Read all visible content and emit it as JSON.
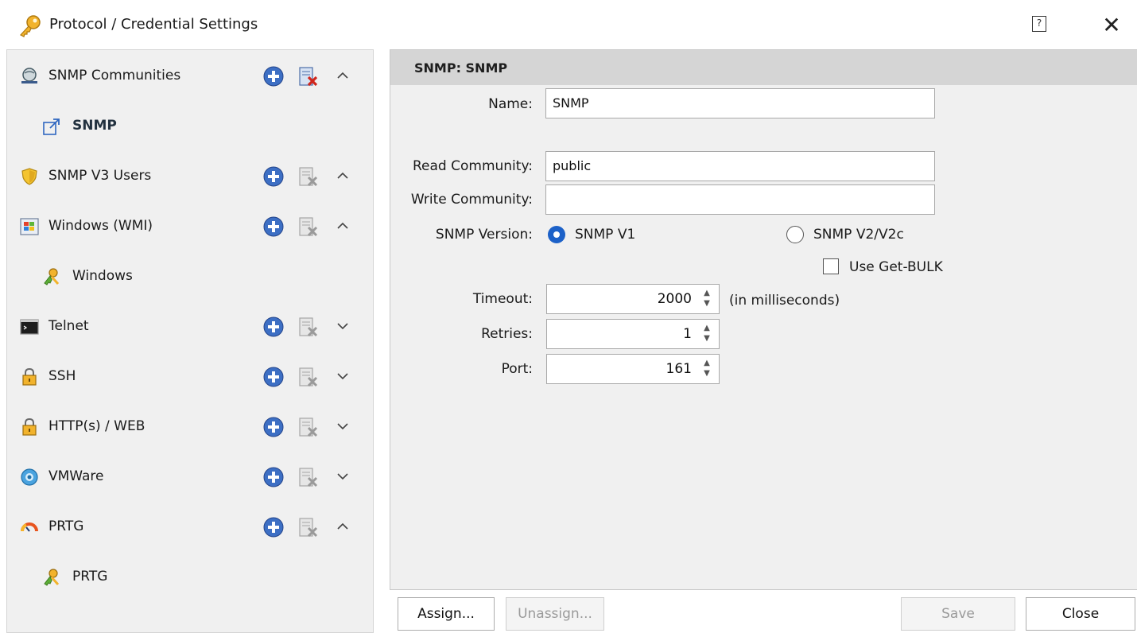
{
  "window": {
    "title": "Protocol / Credential Settings",
    "help_label": "?",
    "close_label": "✕"
  },
  "tree": {
    "snmp_communities": {
      "label": "SNMP Communities",
      "expanded": true
    },
    "snmp_child": {
      "label": "SNMP"
    },
    "snmp_v3_users": {
      "label": "SNMP V3 Users",
      "expanded": true
    },
    "windows_wmi": {
      "label": "Windows (WMI)",
      "expanded": true
    },
    "windows_child": {
      "label": "Windows"
    },
    "telnet": {
      "label": "Telnet",
      "expanded": false
    },
    "ssh": {
      "label": "SSH",
      "expanded": false
    },
    "http_web": {
      "label": "HTTP(s) / WEB",
      "expanded": false
    },
    "vmware": {
      "label": "VMWare",
      "expanded": false
    },
    "prtg": {
      "label": "PRTG",
      "expanded": true
    },
    "prtg_child": {
      "label": "PRTG"
    }
  },
  "form": {
    "header": "SNMP: SNMP",
    "name_label": "Name:",
    "name_value": "SNMP",
    "read_community_label": "Read Community:",
    "read_community_value": "public",
    "write_community_label": "Write Community:",
    "write_community_value": "",
    "snmp_version_label": "SNMP Version:",
    "snmp_v1_label": "SNMP V1",
    "snmp_v2_label": "SNMP V2/V2c",
    "snmp_version_selected": "SNMP V1",
    "use_getbulk_label": "Use Get-BULK",
    "use_getbulk_checked": false,
    "timeout_label": "Timeout:",
    "timeout_value": "2000",
    "timeout_unit": "(in milliseconds)",
    "retries_label": "Retries:",
    "retries_value": "1",
    "port_label": "Port:",
    "port_value": "161"
  },
  "buttons": {
    "assign": "Assign...",
    "unassign": "Unassign...",
    "save": "Save",
    "close": "Close"
  },
  "colors": {
    "accent": "#1c61c8",
    "pane_bg": "#f0f0f0",
    "header_bg": "#d5d5d5",
    "delete_red": "#d0261c"
  }
}
